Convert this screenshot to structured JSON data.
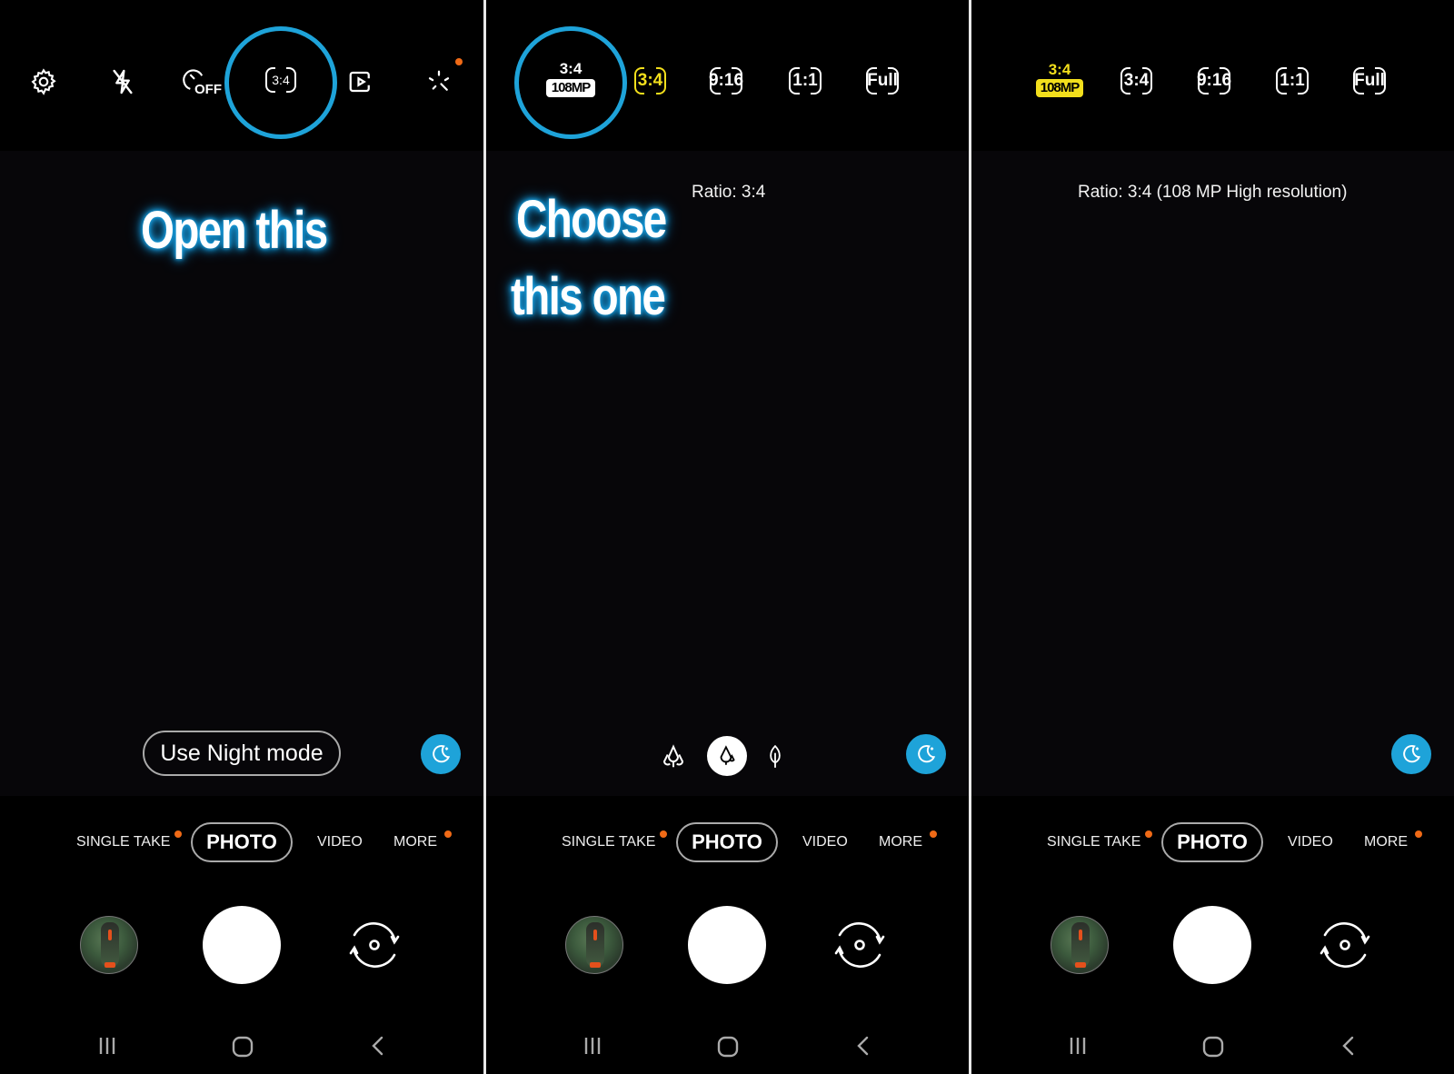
{
  "colors": {
    "highlight_ring": "#1ea3d9",
    "selected_yellow": "#f3df1c",
    "notification_dot": "#f06a16",
    "night_button": "#1ea3d9"
  },
  "panels": [
    {
      "annotation": "Open this",
      "toolbar": {
        "icons": [
          "settings-icon",
          "flash-off-icon",
          "timer-off-icon",
          "aspect-ratio-icon",
          "motion-photo-icon",
          "filters-icon"
        ],
        "timer_label": "OFF",
        "ratio_label": "3:4"
      },
      "night_mode_hint": "Use Night mode",
      "modes": [
        {
          "label": "SINGLE TAKE",
          "dot": true
        },
        {
          "label": "PHOTO",
          "active": true
        },
        {
          "label": "VIDEO"
        },
        {
          "label": "MORE",
          "dot": true
        }
      ]
    },
    {
      "annotation_line1": "Choose",
      "annotation_line2": "this one",
      "ratio_options": [
        {
          "label": "3:4",
          "badge": "108MP",
          "highlighted": true
        },
        {
          "label": "3:4",
          "selected": true
        },
        {
          "label": "9:16"
        },
        {
          "label": "1:1"
        },
        {
          "label": "Full"
        }
      ],
      "ratio_text": "Ratio: 3:4",
      "bokeh_options": [
        "multi-tree-icon",
        "drop-tree-icon",
        "leaf-icon"
      ],
      "modes": [
        {
          "label": "SINGLE TAKE",
          "dot": true
        },
        {
          "label": "PHOTO",
          "active": true
        },
        {
          "label": "VIDEO"
        },
        {
          "label": "MORE",
          "dot": true
        }
      ]
    },
    {
      "ratio_options": [
        {
          "label": "3:4",
          "badge": "108MP",
          "selected": true
        },
        {
          "label": "3:4"
        },
        {
          "label": "9:16"
        },
        {
          "label": "1:1"
        },
        {
          "label": "Full"
        }
      ],
      "ratio_text": "Ratio: 3:4 (108 MP High resolution)",
      "modes": [
        {
          "label": "SINGLE TAKE",
          "dot": true
        },
        {
          "label": "PHOTO",
          "active": true
        },
        {
          "label": "VIDEO"
        },
        {
          "label": "MORE",
          "dot": true
        }
      ]
    }
  ],
  "navbar": {
    "icons": [
      "recent-apps-icon",
      "home-icon",
      "back-icon"
    ]
  }
}
